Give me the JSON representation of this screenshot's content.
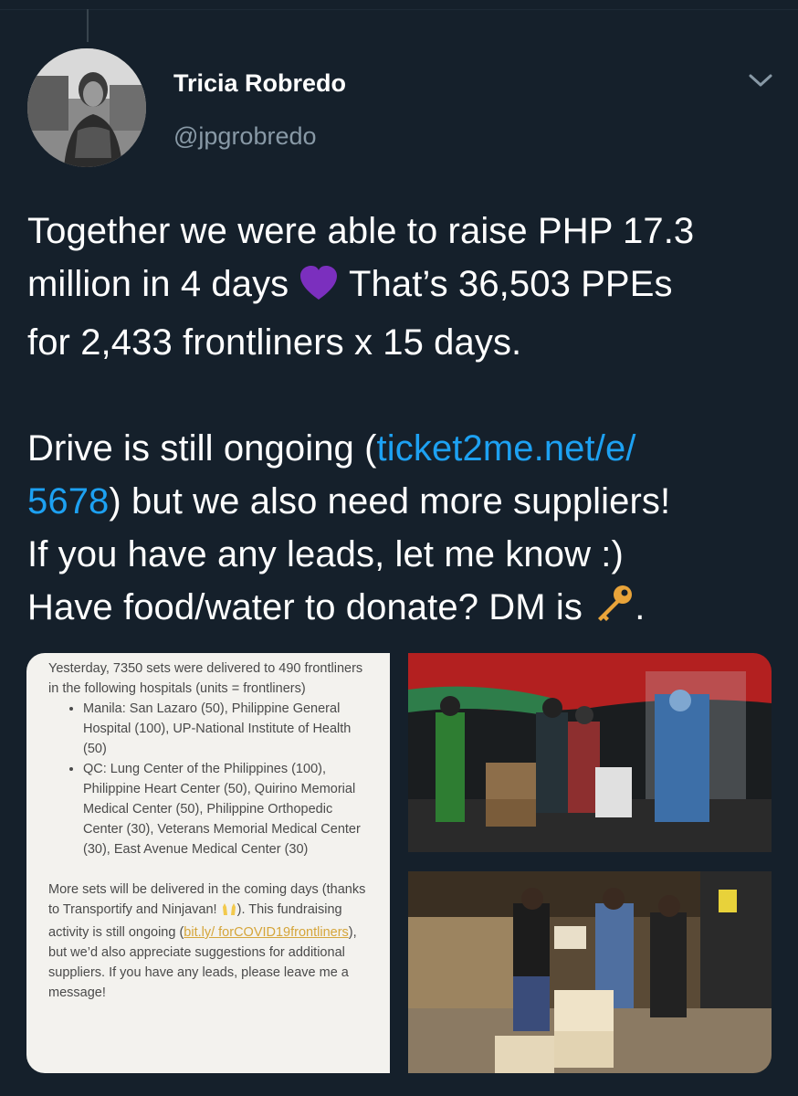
{
  "author": {
    "name": "Tricia Robredo",
    "handle": "@jpgrobredo"
  },
  "tweet": {
    "line1": "Together we were able to raise PHP 17.3",
    "line2a": "million in 4 days ",
    "line2b": " That’s 36,503 PPEs",
    "line3": "for 2,433 frontliners x 15 days.",
    "line5a": "Drive is still ongoing (",
    "link_part1": "ticket2me.net/e/",
    "link_part2": "5678",
    "line6b": ") but we also need more suppliers!",
    "line7": "If you have any leads, let me know :)",
    "line8a": "Have food/water to donate? DM is ",
    "line8b": "."
  },
  "note": {
    "intro": "Yesterday, 7350 sets were delivered to 490 frontliners in the following hospitals (units = frontliners)",
    "items": [
      "Manila: San Lazaro (50), Philippine General Hospital (100), UP-National Institute of Health (50)",
      "QC: Lung Center of the Philippines (100), Philippine Heart Center (50), Quirino Memorial Medical Center (50), Philippine Orthopedic Center (30), Veterans Memorial Medical Center (30), East Avenue Medical Center (30)"
    ],
    "outro_a": "More sets will be delivered in the coming days (thanks to Transportify and Ninjavan! ",
    "outro_b": "). This fundraising activity is still ongoing (",
    "outro_link": "bit.ly/ forCOVID19frontliners",
    "outro_c": "), but we’d also appreciate suggestions for additional suppliers. If you have any leads, please leave me a message!"
  },
  "icons": {
    "heart": "purple-heart-icon",
    "key": "key-icon",
    "hands": "raising-hands-icon",
    "chevron": "chevron-down-icon"
  },
  "colors": {
    "background": "#15202b",
    "link": "#1da1f2",
    "secondary_text": "#8899a6",
    "heart": "#7b2fbe"
  }
}
